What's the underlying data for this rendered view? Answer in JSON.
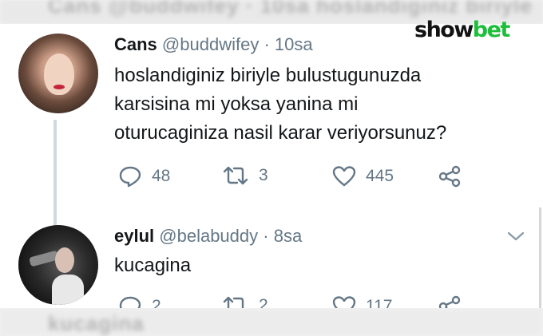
{
  "background_text": {
    "top": "Cans @buddwifey · 10sa hoslandiginiz biriyle",
    "bottom": "kucagina"
  },
  "watermark": {
    "part1": "show",
    "part2": "bet",
    "accent_color": "#1dbf3a"
  },
  "tweets": [
    {
      "name": "Cans",
      "handle": "@buddwifey",
      "separator": "·",
      "time": "10sa",
      "text_lines": [
        "hoslandiginiz biriyle bulustugunuzda",
        "karsisina mi yoksa yanina mi",
        "oturucaginiza nasil karar veriyorsunuz?"
      ],
      "actions": {
        "replies": "48",
        "retweets": "3",
        "likes": "445"
      },
      "icons": [
        "reply-icon",
        "retweet-icon",
        "heart-icon",
        "share-icon"
      ]
    },
    {
      "name": "eylul",
      "handle": "@belabuddy",
      "separator": "·",
      "time": "8sa",
      "text_lines": [
        "kucagina"
      ],
      "actions": {
        "replies": "2",
        "retweets": "2",
        "likes": "117"
      },
      "icons": [
        "reply-icon",
        "retweet-icon",
        "heart-icon",
        "share-icon"
      ]
    }
  ],
  "colors": {
    "text": "#14171a",
    "muted": "#657786",
    "thread_line": "#cfd9de"
  }
}
